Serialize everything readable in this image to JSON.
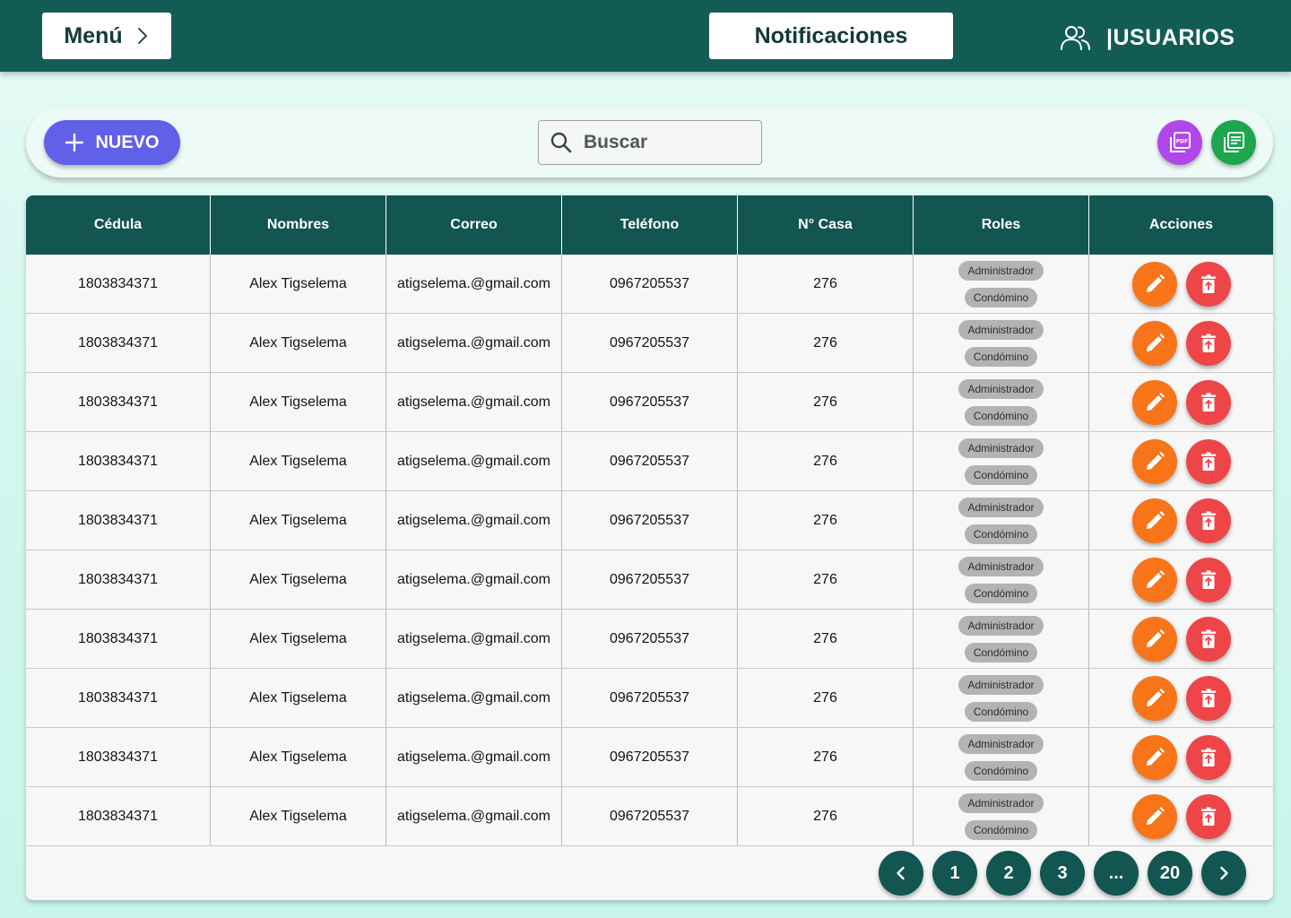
{
  "header": {
    "menu_label": "Menú",
    "notifications_label": "Notificaciones",
    "section_title": "|USUARIOS"
  },
  "toolbar": {
    "new_label": "NUEVO",
    "search_placeholder": "Buscar",
    "pdf_icon": "pdf-icon",
    "excel_icon": "list-document-icon"
  },
  "table": {
    "headers": [
      "Cédula",
      "Nombres",
      "Correo",
      "Teléfono",
      "N° Casa",
      "Roles",
      "Acciones"
    ],
    "rows": [
      {
        "cedula": "1803834371",
        "nombres": "Alex Tigselema",
        "correo": "atigselema.@gmail.com",
        "telefono": "0967205537",
        "casa": "276",
        "roles": [
          "Administrador",
          "Condómino"
        ]
      },
      {
        "cedula": "1803834371",
        "nombres": "Alex Tigselema",
        "correo": "atigselema.@gmail.com",
        "telefono": "0967205537",
        "casa": "276",
        "roles": [
          "Administrador",
          "Condómino"
        ]
      },
      {
        "cedula": "1803834371",
        "nombres": "Alex Tigselema",
        "correo": "atigselema.@gmail.com",
        "telefono": "0967205537",
        "casa": "276",
        "roles": [
          "Administrador",
          "Condómino"
        ]
      },
      {
        "cedula": "1803834371",
        "nombres": "Alex Tigselema",
        "correo": "atigselema.@gmail.com",
        "telefono": "0967205537",
        "casa": "276",
        "roles": [
          "Administrador",
          "Condómino"
        ]
      },
      {
        "cedula": "1803834371",
        "nombres": "Alex Tigselema",
        "correo": "atigselema.@gmail.com",
        "telefono": "0967205537",
        "casa": "276",
        "roles": [
          "Administrador",
          "Condómino"
        ]
      },
      {
        "cedula": "1803834371",
        "nombres": "Alex Tigselema",
        "correo": "atigselema.@gmail.com",
        "telefono": "0967205537",
        "casa": "276",
        "roles": [
          "Administrador",
          "Condómino"
        ]
      },
      {
        "cedula": "1803834371",
        "nombres": "Alex Tigselema",
        "correo": "atigselema.@gmail.com",
        "telefono": "0967205537",
        "casa": "276",
        "roles": [
          "Administrador",
          "Condómino"
        ]
      },
      {
        "cedula": "1803834371",
        "nombres": "Alex Tigselema",
        "correo": "atigselema.@gmail.com",
        "telefono": "0967205537",
        "casa": "276",
        "roles": [
          "Administrador",
          "Condómino"
        ]
      },
      {
        "cedula": "1803834371",
        "nombres": "Alex Tigselema",
        "correo": "atigselema.@gmail.com",
        "telefono": "0967205537",
        "casa": "276",
        "roles": [
          "Administrador",
          "Condómino"
        ]
      },
      {
        "cedula": "1803834371",
        "nombres": "Alex Tigselema",
        "correo": "atigselema.@gmail.com",
        "telefono": "0967205537",
        "casa": "276",
        "roles": [
          "Administrador",
          "Condómino"
        ]
      }
    ]
  },
  "pagination": {
    "pages": [
      "1",
      "2",
      "3",
      "...",
      "20"
    ]
  },
  "colors": {
    "header_bg": "#135c56",
    "accent_new": "#6160e9",
    "pdf": "#b047e9",
    "excel": "#1da64e",
    "edit": "#f87419",
    "delete": "#ee4549"
  }
}
